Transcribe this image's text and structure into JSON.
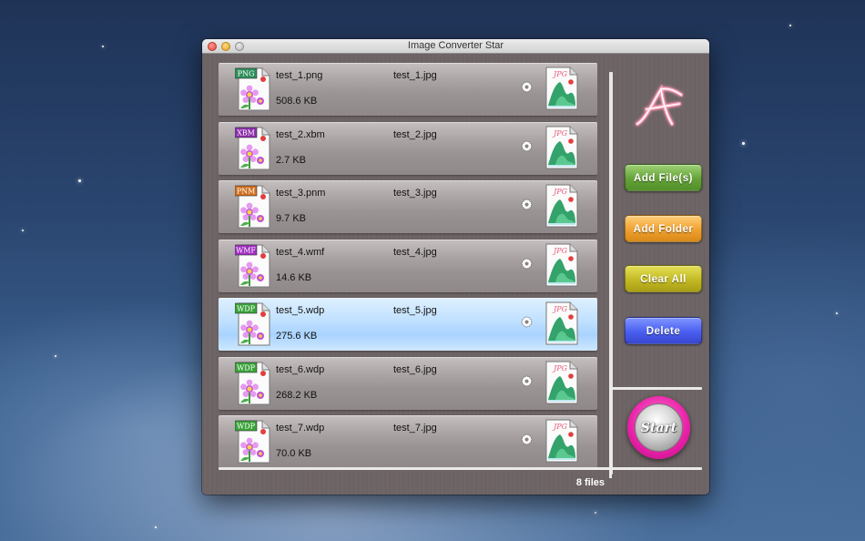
{
  "window": {
    "title": "Image Converter Star"
  },
  "files": [
    {
      "source_name": "test_1.png",
      "source_size": "508.6 KB",
      "output_name": "test_1.jpg",
      "source_format": "PNG",
      "format_color": "#2f8f5b",
      "selected": false
    },
    {
      "source_name": "test_2.xbm",
      "source_size": "2.7 KB",
      "output_name": "test_2.jpg",
      "source_format": "XBM",
      "format_color": "#8b2fa8",
      "selected": false
    },
    {
      "source_name": "test_3.pnm",
      "source_size": "9.7 KB",
      "output_name": "test_3.jpg",
      "source_format": "PNM",
      "format_color": "#d0701f",
      "selected": false
    },
    {
      "source_name": "test_4.wmf",
      "source_size": "14.6 KB",
      "output_name": "test_4.jpg",
      "source_format": "WMF",
      "format_color": "#a02fc2",
      "selected": false
    },
    {
      "source_name": "test_5.wdp",
      "source_size": "275.6 KB",
      "output_name": "test_5.jpg",
      "source_format": "WDP",
      "format_color": "#3aa33a",
      "selected": true
    },
    {
      "source_name": "test_6.wdp",
      "source_size": "268.2 KB",
      "output_name": "test_6.jpg",
      "source_format": "WDP",
      "format_color": "#3aa33a",
      "selected": false
    },
    {
      "source_name": "test_7.wdp",
      "source_size": "70.0 KB",
      "output_name": "test_7.jpg",
      "source_format": "WDP",
      "format_color": "#3aa33a",
      "selected": false
    }
  ],
  "output_format": "JPG",
  "buttons": {
    "add_files": "Add File(s)",
    "add_folder": "Add Folder",
    "clear_all": "Clear All",
    "delete": "Delete",
    "start": "Start"
  },
  "status": {
    "file_count": "8 files"
  },
  "icons": {
    "logo": "app-logo-icon",
    "settings": "gear-icon",
    "output": "jpg-file-icon"
  }
}
